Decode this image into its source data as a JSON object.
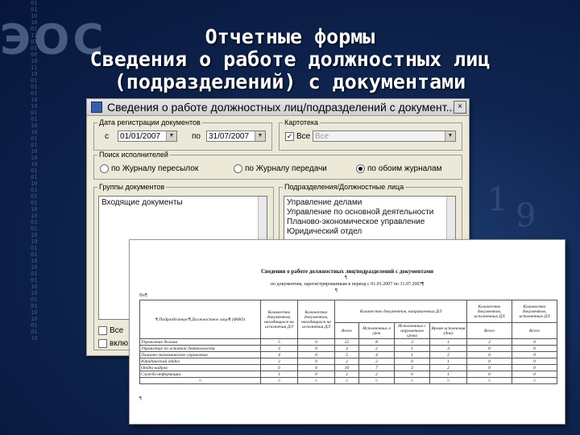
{
  "slide": {
    "title_lines": [
      "Отчетные формы",
      "Сведения о работе должностных лиц",
      "(подразделений) с документами"
    ]
  },
  "window": {
    "title": "Сведения о работе должностных лиц/подразделений с документ...",
    "close": "×",
    "period_group": {
      "legend": "Дата регистрации документов",
      "from_label": "с",
      "from_value": "01/01/2007",
      "to_label": "по",
      "to_value": "31/07/2007"
    },
    "cartotheca_group": {
      "legend": "Картотека",
      "all_label": "Все",
      "all_checked": true,
      "value": "Все"
    },
    "search_group": {
      "legend": "Поиск исполнителей",
      "options": [
        "по Журналу пересылок",
        "по Журналу передачи",
        "по обоим журналам"
      ],
      "selected_index": 2
    },
    "doc_groups": {
      "legend": "Группы документов",
      "items": [
        "Входящие документы"
      ],
      "all_label": "Все",
      "include_label": "вклю"
    },
    "departments": {
      "legend": "Подразделения/Должностные лица",
      "items": [
        "Управление делами",
        "Управление по основной деятельности",
        "Планово-экономическое управление",
        "Юридический отдел"
      ]
    }
  },
  "report": {
    "title": "Сведения о работе должностных лиц/подразделений с документами",
    "pilcrow": "¶",
    "period": "по документам, зарегистрированным в период с 01.01.2007 по 31.07.2007¶",
    "table_marker": "Вх¶",
    "headers": [
      "¶ Подразделение/¶ Должностное лицо¶ (ФИО)",
      "Количество документов, находящихся на исполнении ДЛ",
      "Количество документов, находящихся на исполнении ДЛ",
      "Количество документов, направленных ДЛ",
      "Количество документов, исполненных ДЛ",
      "Количество документов, исполненных ДЛ"
    ],
    "subheaders": [
      "Всего",
      "Исполненных в срок",
      "Исполненных с нарушением срока",
      "Время исполнения (дни)",
      "Всего",
      "Всего"
    ],
    "rows": [
      [
        "Управление делами",
        "5",
        "0",
        "12",
        "8",
        "3",
        "1",
        "2",
        "0"
      ],
      [
        "Управление по основной деятельности",
        "3",
        "0",
        "3",
        "2",
        "1",
        "3",
        "0",
        "0"
      ],
      [
        "Планово-экономическое управление",
        "4",
        "0",
        "5",
        "4",
        "1",
        "2",
        "0",
        "0"
      ],
      [
        "Юридический отдел",
        "2",
        "0",
        "2",
        "2",
        "0",
        "1",
        "0",
        "0"
      ],
      [
        "Отдел кадров",
        "6",
        "0",
        "10",
        "7",
        "3",
        "2",
        "0",
        "0"
      ],
      [
        "Служба информации",
        "1",
        "0",
        "2",
        "2",
        "0",
        "1",
        "0",
        "0"
      ]
    ],
    "end_mark": "¤",
    "bottom_pilcrow": "¶"
  }
}
